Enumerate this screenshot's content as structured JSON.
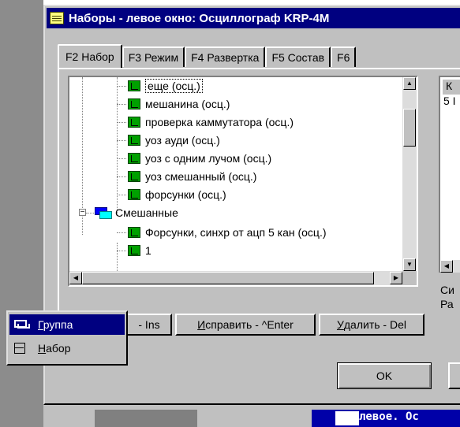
{
  "window": {
    "title": "Наборы - левое окно: Осциллограф KRP-4M"
  },
  "tabs": [
    {
      "label": "F2 Набор",
      "active": true
    },
    {
      "label": "F3 Режим",
      "active": false
    },
    {
      "label": "F4 Развертка",
      "active": false
    },
    {
      "label": "F5 Состав",
      "active": false
    },
    {
      "label": "F6",
      "active": false
    }
  ],
  "tree": {
    "items": [
      {
        "label": "еще (осц.)",
        "type": "leaf",
        "selected": true
      },
      {
        "label": "мешанина (осц.)",
        "type": "leaf"
      },
      {
        "label": "проверка каммутатора (осц.)",
        "type": "leaf"
      },
      {
        "label": "уоз ауди (осц.)",
        "type": "leaf"
      },
      {
        "label": "уоз с одним лучом (осц.)",
        "type": "leaf"
      },
      {
        "label": "уоз смешанный (осц.)",
        "type": "leaf"
      },
      {
        "label": "форсунки (осц.)",
        "type": "leaf"
      },
      {
        "label": "Смешанные",
        "type": "group"
      },
      {
        "label": " Форсунки, синхр от ацп 5 кан (осц.)",
        "type": "leaf"
      },
      {
        "label": "1",
        "type": "leaf"
      }
    ]
  },
  "right_panel": {
    "header": "К",
    "value": "5 I",
    "label1": "Си",
    "label2": "Ра"
  },
  "buttons": {
    "add_suffix": "- Ins",
    "edit": "Исправить - ^Enter",
    "edit_mnemonic": "И",
    "edit_rest": "справить - ^Enter",
    "delete_mnemonic": "У",
    "delete_rest": "далить - Del",
    "ok": "OK"
  },
  "context_menu": {
    "items": [
      {
        "label_mnemonic": "Г",
        "label_rest": "руппа",
        "icon": "group-icon",
        "highlighted": true
      },
      {
        "label_mnemonic": "Н",
        "label_rest": "абор",
        "icon": "set-icon",
        "highlighted": false
      }
    ]
  },
  "background": {
    "status_text": "левое. Ос"
  }
}
